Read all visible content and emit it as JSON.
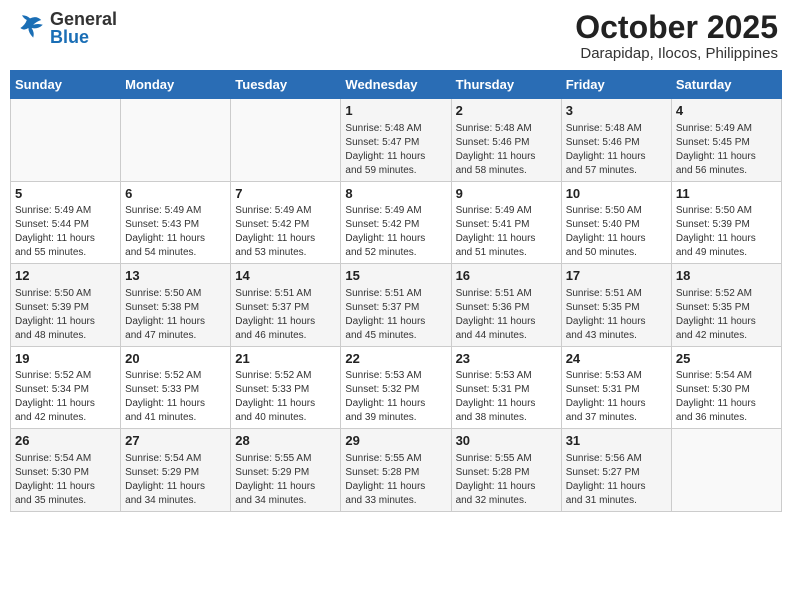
{
  "header": {
    "logo_general": "General",
    "logo_blue": "Blue",
    "month_title": "October 2025",
    "location": "Darapidap, Ilocos, Philippines"
  },
  "calendar": {
    "days_of_week": [
      "Sunday",
      "Monday",
      "Tuesday",
      "Wednesday",
      "Thursday",
      "Friday",
      "Saturday"
    ],
    "weeks": [
      [
        {
          "day": "",
          "info": ""
        },
        {
          "day": "",
          "info": ""
        },
        {
          "day": "",
          "info": ""
        },
        {
          "day": "1",
          "info": "Sunrise: 5:48 AM\nSunset: 5:47 PM\nDaylight: 11 hours\nand 59 minutes."
        },
        {
          "day": "2",
          "info": "Sunrise: 5:48 AM\nSunset: 5:46 PM\nDaylight: 11 hours\nand 58 minutes."
        },
        {
          "day": "3",
          "info": "Sunrise: 5:48 AM\nSunset: 5:46 PM\nDaylight: 11 hours\nand 57 minutes."
        },
        {
          "day": "4",
          "info": "Sunrise: 5:49 AM\nSunset: 5:45 PM\nDaylight: 11 hours\nand 56 minutes."
        }
      ],
      [
        {
          "day": "5",
          "info": "Sunrise: 5:49 AM\nSunset: 5:44 PM\nDaylight: 11 hours\nand 55 minutes."
        },
        {
          "day": "6",
          "info": "Sunrise: 5:49 AM\nSunset: 5:43 PM\nDaylight: 11 hours\nand 54 minutes."
        },
        {
          "day": "7",
          "info": "Sunrise: 5:49 AM\nSunset: 5:42 PM\nDaylight: 11 hours\nand 53 minutes."
        },
        {
          "day": "8",
          "info": "Sunrise: 5:49 AM\nSunset: 5:42 PM\nDaylight: 11 hours\nand 52 minutes."
        },
        {
          "day": "9",
          "info": "Sunrise: 5:49 AM\nSunset: 5:41 PM\nDaylight: 11 hours\nand 51 minutes."
        },
        {
          "day": "10",
          "info": "Sunrise: 5:50 AM\nSunset: 5:40 PM\nDaylight: 11 hours\nand 50 minutes."
        },
        {
          "day": "11",
          "info": "Sunrise: 5:50 AM\nSunset: 5:39 PM\nDaylight: 11 hours\nand 49 minutes."
        }
      ],
      [
        {
          "day": "12",
          "info": "Sunrise: 5:50 AM\nSunset: 5:39 PM\nDaylight: 11 hours\nand 48 minutes."
        },
        {
          "day": "13",
          "info": "Sunrise: 5:50 AM\nSunset: 5:38 PM\nDaylight: 11 hours\nand 47 minutes."
        },
        {
          "day": "14",
          "info": "Sunrise: 5:51 AM\nSunset: 5:37 PM\nDaylight: 11 hours\nand 46 minutes."
        },
        {
          "day": "15",
          "info": "Sunrise: 5:51 AM\nSunset: 5:37 PM\nDaylight: 11 hours\nand 45 minutes."
        },
        {
          "day": "16",
          "info": "Sunrise: 5:51 AM\nSunset: 5:36 PM\nDaylight: 11 hours\nand 44 minutes."
        },
        {
          "day": "17",
          "info": "Sunrise: 5:51 AM\nSunset: 5:35 PM\nDaylight: 11 hours\nand 43 minutes."
        },
        {
          "day": "18",
          "info": "Sunrise: 5:52 AM\nSunset: 5:35 PM\nDaylight: 11 hours\nand 42 minutes."
        }
      ],
      [
        {
          "day": "19",
          "info": "Sunrise: 5:52 AM\nSunset: 5:34 PM\nDaylight: 11 hours\nand 42 minutes."
        },
        {
          "day": "20",
          "info": "Sunrise: 5:52 AM\nSunset: 5:33 PM\nDaylight: 11 hours\nand 41 minutes."
        },
        {
          "day": "21",
          "info": "Sunrise: 5:52 AM\nSunset: 5:33 PM\nDaylight: 11 hours\nand 40 minutes."
        },
        {
          "day": "22",
          "info": "Sunrise: 5:53 AM\nSunset: 5:32 PM\nDaylight: 11 hours\nand 39 minutes."
        },
        {
          "day": "23",
          "info": "Sunrise: 5:53 AM\nSunset: 5:31 PM\nDaylight: 11 hours\nand 38 minutes."
        },
        {
          "day": "24",
          "info": "Sunrise: 5:53 AM\nSunset: 5:31 PM\nDaylight: 11 hours\nand 37 minutes."
        },
        {
          "day": "25",
          "info": "Sunrise: 5:54 AM\nSunset: 5:30 PM\nDaylight: 11 hours\nand 36 minutes."
        }
      ],
      [
        {
          "day": "26",
          "info": "Sunrise: 5:54 AM\nSunset: 5:30 PM\nDaylight: 11 hours\nand 35 minutes."
        },
        {
          "day": "27",
          "info": "Sunrise: 5:54 AM\nSunset: 5:29 PM\nDaylight: 11 hours\nand 34 minutes."
        },
        {
          "day": "28",
          "info": "Sunrise: 5:55 AM\nSunset: 5:29 PM\nDaylight: 11 hours\nand 34 minutes."
        },
        {
          "day": "29",
          "info": "Sunrise: 5:55 AM\nSunset: 5:28 PM\nDaylight: 11 hours\nand 33 minutes."
        },
        {
          "day": "30",
          "info": "Sunrise: 5:55 AM\nSunset: 5:28 PM\nDaylight: 11 hours\nand 32 minutes."
        },
        {
          "day": "31",
          "info": "Sunrise: 5:56 AM\nSunset: 5:27 PM\nDaylight: 11 hours\nand 31 minutes."
        },
        {
          "day": "",
          "info": ""
        }
      ]
    ]
  }
}
